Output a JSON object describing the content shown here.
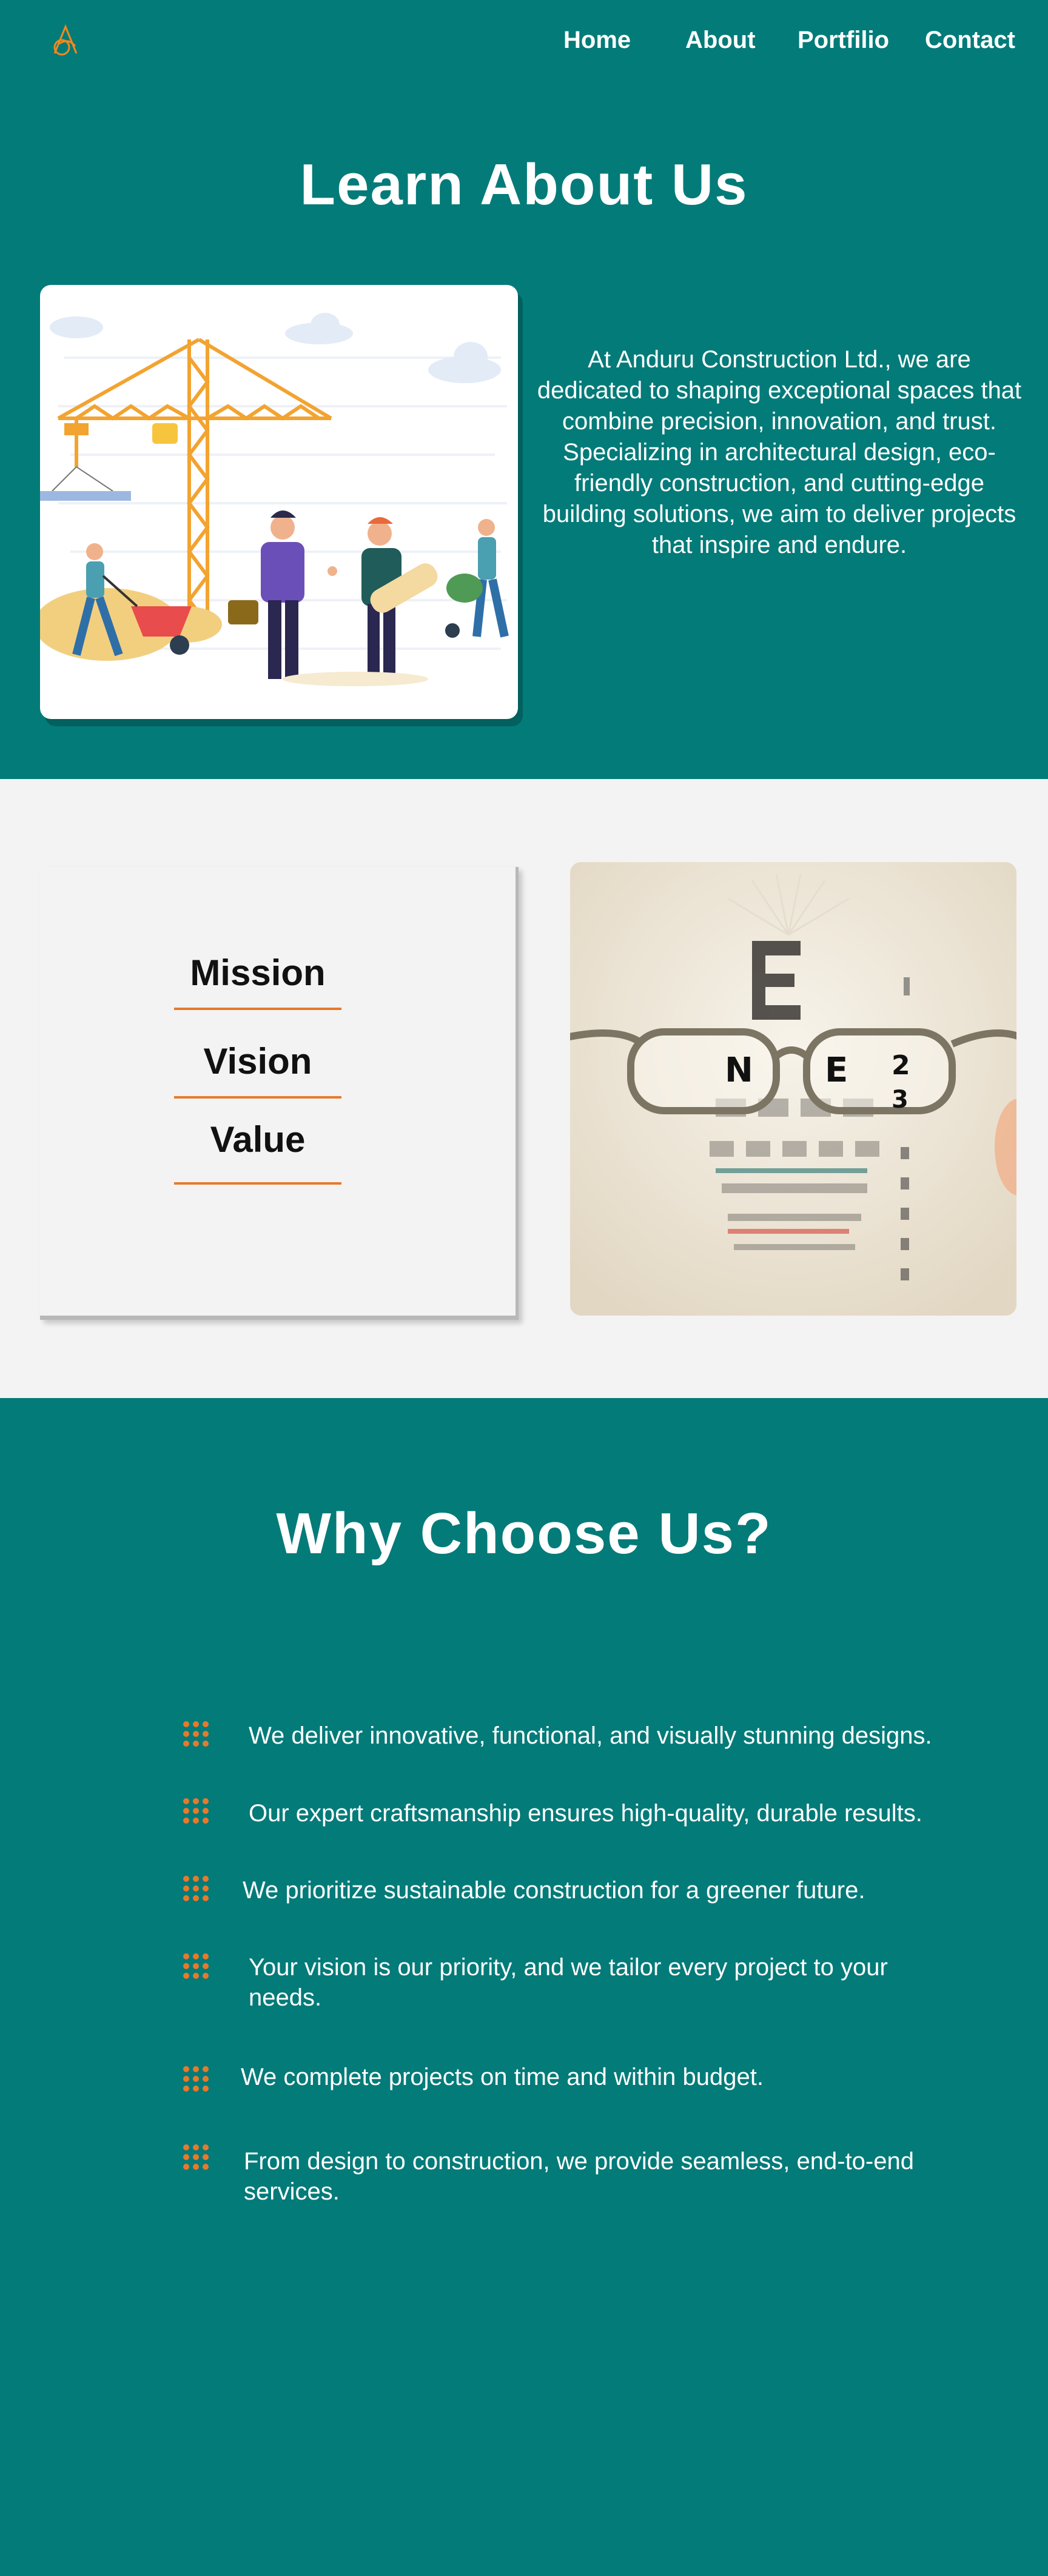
{
  "nav": {
    "logo_name": "anduru-logo",
    "items": [
      {
        "label": "Home"
      },
      {
        "label": "About"
      },
      {
        "label": "Portfilio"
      },
      {
        "label": "Contact"
      }
    ]
  },
  "hero": {
    "title": "Learn About Us",
    "description": "At Anduru Construction Ltd., we are dedicated to shaping exceptional spaces that combine precision, innovation, and trust. Specializing in architectural design, eco-friendly construction, and cutting-edge building solutions, we aim to deliver projects that inspire and endure.",
    "image": "construction-team-illustration"
  },
  "mvv": {
    "items": [
      {
        "label": "Mission"
      },
      {
        "label": "Vision"
      },
      {
        "label": "Value"
      }
    ],
    "image": "eye-chart-with-glasses"
  },
  "why": {
    "title": "Why Choose Us?",
    "items": [
      {
        "text": "We deliver innovative, functional, and visually stunning designs."
      },
      {
        "text": "Our expert craftsmanship ensures high-quality, durable results."
      },
      {
        "text": "We prioritize sustainable construction for a greener future."
      },
      {
        "text": "Your vision is our priority, and we tailor every project to your needs."
      },
      {
        "text": "We complete projects on time and within budget."
      },
      {
        "text": "From design to construction, we provide seamless, end-to-end services."
      }
    ]
  },
  "colors": {
    "teal": "#037b79",
    "accent_orange": "#e8792b",
    "light_gray": "#f3f3f3"
  }
}
